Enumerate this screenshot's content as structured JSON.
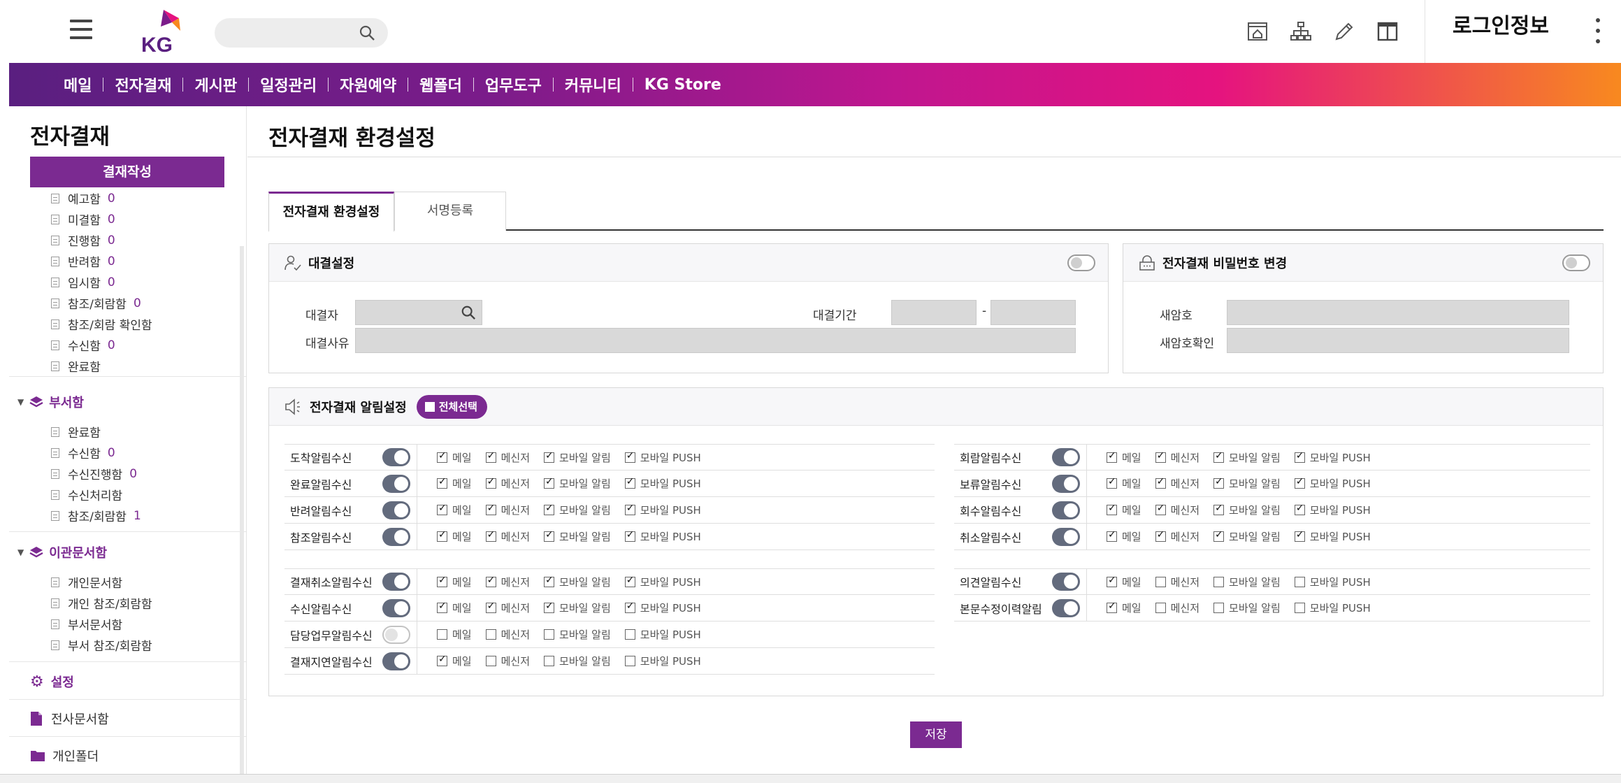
{
  "header": {
    "login_label": "로그인정보",
    "search_placeholder": ""
  },
  "nav": {
    "items": [
      "메일",
      "전자결재",
      "게시판",
      "일정관리",
      "자원예약",
      "웹폴더",
      "업무도구",
      "커뮤니티",
      "KG Store"
    ]
  },
  "sidebar": {
    "title": "전자결재",
    "compose_label": "결재작성",
    "personal_boxes": [
      {
        "label": "예고함",
        "count": "0"
      },
      {
        "label": "미결함",
        "count": "0"
      },
      {
        "label": "진행함",
        "count": "0"
      },
      {
        "label": "반려함",
        "count": "0"
      },
      {
        "label": "임시함",
        "count": "0"
      },
      {
        "label": "참조/회람함",
        "count": "0"
      },
      {
        "label": "참조/회람 확인함",
        "count": ""
      },
      {
        "label": "수신함",
        "count": "0"
      },
      {
        "label": "완료함",
        "count": ""
      }
    ],
    "dept_group": "부서함",
    "dept_boxes": [
      {
        "label": "완료함",
        "count": ""
      },
      {
        "label": "수신함",
        "count": "0"
      },
      {
        "label": "수신진행함",
        "count": "0"
      },
      {
        "label": "수신처리함",
        "count": ""
      },
      {
        "label": "참조/회람함",
        "count": "1"
      }
    ],
    "transfer_group": "이관문서함",
    "transfer_boxes": [
      {
        "label": "개인문서함"
      },
      {
        "label": "개인 참조/회람함"
      },
      {
        "label": "부서문서함"
      },
      {
        "label": "부서 참조/회람함"
      }
    ],
    "settings_label": "설정",
    "company_docs_label": "전사문서함",
    "personal_folder_label": "개인폴더"
  },
  "main": {
    "title": "전자결재 환경설정",
    "tabs": [
      "전자결재 환경설정",
      "서명등록"
    ],
    "proxy": {
      "title": "대결설정",
      "approver_label": "대결자",
      "period_label": "대결기간",
      "period_sep": "-",
      "reason_label": "대결사유"
    },
    "password": {
      "title": "전자결재 비밀번호 변경",
      "new_label": "새암호",
      "confirm_label": "새암호확인"
    },
    "notify": {
      "title": "전자결재 알림설정",
      "select_all": "전체선택",
      "options": [
        "메일",
        "메신저",
        "모바일 알림",
        "모바일 PUSH"
      ],
      "left_group1": [
        {
          "label": "도착알림수신",
          "on": true,
          "checks": [
            true,
            true,
            true,
            true
          ]
        },
        {
          "label": "완료알림수신",
          "on": true,
          "checks": [
            true,
            true,
            true,
            true
          ]
        },
        {
          "label": "반려알림수신",
          "on": true,
          "checks": [
            true,
            true,
            true,
            true
          ]
        },
        {
          "label": "참조알림수신",
          "on": true,
          "checks": [
            true,
            true,
            true,
            true
          ]
        }
      ],
      "right_group1": [
        {
          "label": "회람알림수신",
          "on": true,
          "checks": [
            true,
            true,
            true,
            true
          ]
        },
        {
          "label": "보류알림수신",
          "on": true,
          "checks": [
            true,
            true,
            true,
            true
          ]
        },
        {
          "label": "회수알림수신",
          "on": true,
          "checks": [
            true,
            true,
            true,
            true
          ]
        },
        {
          "label": "취소알림수신",
          "on": true,
          "checks": [
            true,
            true,
            true,
            true
          ]
        }
      ],
      "left_group2": [
        {
          "label": "결재취소알림수신",
          "on": true,
          "checks": [
            true,
            true,
            true,
            true
          ]
        },
        {
          "label": "수신알림수신",
          "on": true,
          "checks": [
            true,
            true,
            true,
            true
          ]
        },
        {
          "label": "담당업무알림수신",
          "on": false,
          "checks": [
            false,
            false,
            false,
            false
          ]
        },
        {
          "label": "결재지연알림수신",
          "on": true,
          "checks": [
            true,
            false,
            false,
            false
          ]
        }
      ],
      "right_group2": [
        {
          "label": "의견알림수신",
          "on": true,
          "checks": [
            true,
            false,
            false,
            false
          ]
        },
        {
          "label": "본문수정이력알림",
          "on": true,
          "checks": [
            true,
            false,
            false,
            false
          ]
        }
      ]
    },
    "save_label": "저장"
  },
  "colors": {
    "brand_purple": "#7b2a91",
    "switch_on": "#636b7d",
    "nav_gradient_start": "#5a1f80",
    "nav_gradient_end": "#f8891f"
  }
}
